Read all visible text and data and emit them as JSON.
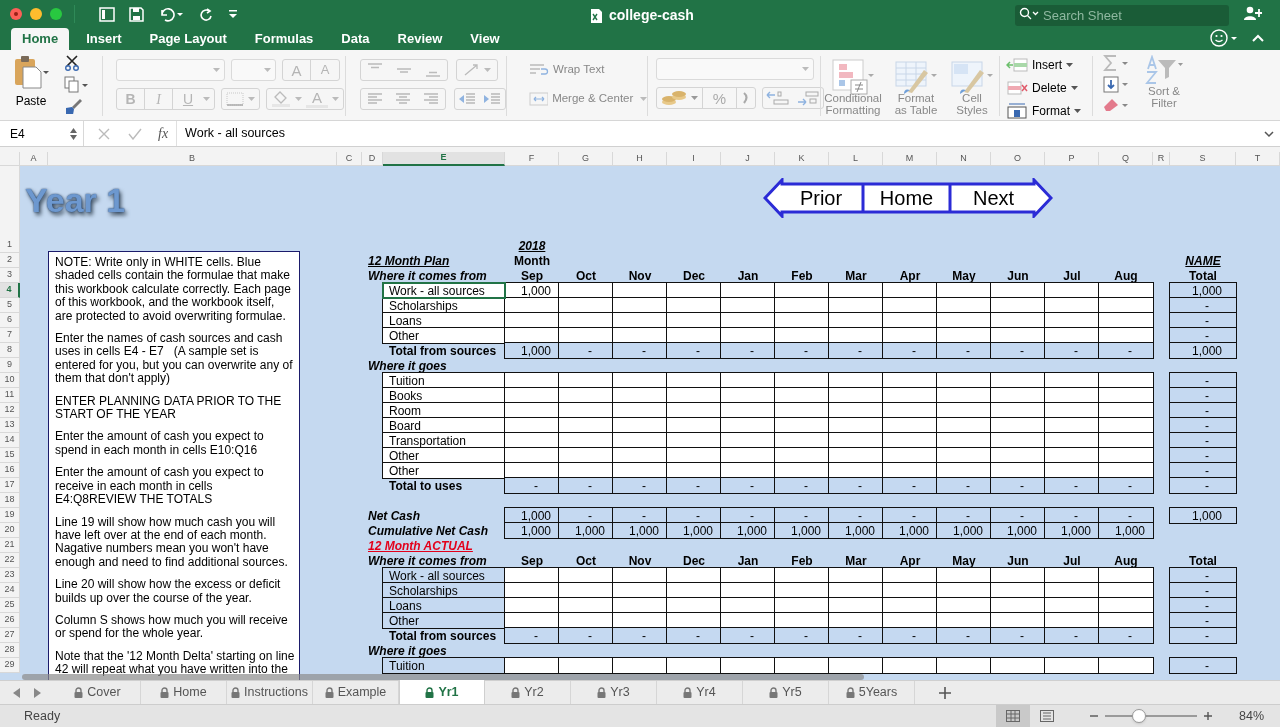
{
  "window": {
    "title": "college-cash",
    "search_placeholder": "Search Sheet"
  },
  "tabs": [
    {
      "label": "Home",
      "selected": true
    },
    {
      "label": "Insert",
      "selected": false
    },
    {
      "label": "Page Layout",
      "selected": false
    },
    {
      "label": "Formulas",
      "selected": false
    },
    {
      "label": "Data",
      "selected": false
    },
    {
      "label": "Review",
      "selected": false
    },
    {
      "label": "View",
      "selected": false
    }
  ],
  "ribbon": {
    "paste": "Paste",
    "grow_font": "A",
    "shrink_font": "A",
    "bold": "B",
    "italic": "I",
    "underline": "U",
    "font_color": "A",
    "wrap_text": "Wrap Text",
    "merge": "Merge & Center",
    "percent": "%",
    "styles": [
      "Conditional Formatting",
      "Format as Table",
      "Cell Styles"
    ],
    "cells": [
      "Insert",
      "Delete",
      "Format"
    ],
    "sort_filter": "Sort & Filter"
  },
  "formula_bar": {
    "name_box": "E4",
    "fx": "fx",
    "value": "Work - all sources"
  },
  "columns": [
    {
      "label": "A",
      "selected": false
    },
    {
      "label": "B",
      "selected": false
    },
    {
      "label": "C",
      "selected": false
    },
    {
      "label": "D",
      "selected": false
    },
    {
      "label": "E",
      "selected": true
    },
    {
      "label": "F",
      "selected": false
    },
    {
      "label": "G",
      "selected": false
    },
    {
      "label": "H",
      "selected": false
    },
    {
      "label": "I",
      "selected": false
    },
    {
      "label": "J",
      "selected": false
    },
    {
      "label": "K",
      "selected": false
    },
    {
      "label": "L",
      "selected": false
    },
    {
      "label": "M",
      "selected": false
    },
    {
      "label": "N",
      "selected": false
    },
    {
      "label": "O",
      "selected": false
    },
    {
      "label": "P",
      "selected": false
    },
    {
      "label": "Q",
      "selected": false
    },
    {
      "label": "R",
      "selected": false
    },
    {
      "label": "S",
      "selected": false
    },
    {
      "label": "T",
      "selected": false
    }
  ],
  "row_numbers": [
    {
      "label": "1",
      "selected": false
    },
    {
      "label": "2",
      "selected": false
    },
    {
      "label": "3",
      "selected": false
    },
    {
      "label": "4",
      "selected": true
    },
    {
      "label": "5",
      "selected": false
    },
    {
      "label": "6",
      "selected": false
    },
    {
      "label": "7",
      "selected": false
    },
    {
      "label": "8",
      "selected": false
    },
    {
      "label": "9",
      "selected": false
    },
    {
      "label": "10",
      "selected": false
    },
    {
      "label": "11",
      "selected": false
    },
    {
      "label": "12",
      "selected": false
    },
    {
      "label": "13",
      "selected": false
    },
    {
      "label": "14",
      "selected": false
    },
    {
      "label": "15",
      "selected": false
    },
    {
      "label": "16",
      "selected": false
    },
    {
      "label": "17",
      "selected": false
    },
    {
      "label": "18",
      "selected": false
    },
    {
      "label": "19",
      "selected": false
    },
    {
      "label": "20",
      "selected": false
    },
    {
      "label": "21",
      "selected": false
    },
    {
      "label": "22",
      "selected": false
    },
    {
      "label": "23",
      "selected": false
    },
    {
      "label": "24",
      "selected": false
    },
    {
      "label": "25",
      "selected": false
    },
    {
      "label": "26",
      "selected": false
    },
    {
      "label": "27",
      "selected": false
    },
    {
      "label": "28",
      "selected": false
    },
    {
      "label": "29",
      "selected": false
    }
  ],
  "sheet": {
    "title": "Year 1",
    "nav_buttons": [
      "Prior",
      "Home",
      "Next"
    ],
    "note": [
      "NOTE: Write only in WHITE cells. Blue shaded cells contain the formulae that make this workbook calculate correctly. Each page of this workbook, and the workbook itself, are protected to avoid overwriting formulae.",
      "Enter the names of cash sources and cash uses in cells E4 - E7   (A sample set is entered for you, but you can overwrite any of them that don't apply)",
      "ENTER PLANNING DATA PRIOR TO THE START OF THE YEAR",
      "Enter the amount of cash you expect to spend in each month in cells E10:Q16",
      "Enter the amount of cash you expect to receive in each month in cells E4:Q8REVIEW THE TOTALS",
      "Line 19 will show how much cash you will have left over at the end of each month. Nagative numbers mean you won't have enough and need to find additional sources.",
      "Line 20 will show how the excess or deficit builds up over the course of the year.",
      "Column S shows how much you will receive or spend for the whole year.",
      "Note that the '12 Month Delta' starting on line 42 will repeat what you have written into the"
    ]
  },
  "plan": {
    "year": "2018",
    "title": "12 Month Plan",
    "month_label": "Month",
    "name_label": "NAME",
    "labels_shaded": false,
    "sources_header": "Where it comes from",
    "months": [
      "Sep",
      "Oct",
      "Nov",
      "Dec",
      "Jan",
      "Feb",
      "Mar",
      "Apr",
      "May",
      "Jun",
      "Jul",
      "Aug"
    ],
    "total_header": "Total",
    "sources": [
      {
        "label": "Work - all sources",
        "selected": true,
        "values": [
          "1,000"
        ],
        "total": "1,000"
      },
      {
        "label": "Scholarships",
        "selected": false,
        "total": "-"
      },
      {
        "label": "Loans",
        "selected": false,
        "total": "-"
      },
      {
        "label": "Other",
        "selected": false,
        "total": "-"
      }
    ],
    "sources_total": {
      "label": "Total from sources",
      "values": [
        "1,000",
        "-",
        "-",
        "-",
        "-",
        "-",
        "-",
        "-",
        "-",
        "-",
        "-",
        "-"
      ],
      "total": "1,000"
    },
    "uses_header": "Where it goes",
    "uses": [
      {
        "label": "Tuition",
        "selected": false,
        "total": "-"
      },
      {
        "label": "Books",
        "selected": false,
        "total": "-"
      },
      {
        "label": "Room",
        "selected": false,
        "total": "-"
      },
      {
        "label": "Board",
        "selected": false,
        "total": "-"
      },
      {
        "label": "Transportation",
        "selected": false,
        "total": "-"
      },
      {
        "label": "Other",
        "selected": false,
        "total": "-"
      },
      {
        "label": "Other",
        "selected": false,
        "total": "-"
      }
    ],
    "uses_total": {
      "label": "Total to uses",
      "values": [
        "-",
        "-",
        "-",
        "-",
        "-",
        "-",
        "-",
        "-",
        "-",
        "-",
        "-",
        "-"
      ],
      "total": "-"
    },
    "net_cash": {
      "label": "Net Cash",
      "values": [
        "1,000",
        "-",
        "-",
        "-",
        "-",
        "-",
        "-",
        "-",
        "-",
        "-",
        "-",
        "-"
      ],
      "total": "1,000"
    },
    "cumulative": {
      "label": "Cumulative Net Cash",
      "values": [
        "1,000",
        "1,000",
        "1,000",
        "1,000",
        "1,000",
        "1,000",
        "1,000",
        "1,000",
        "1,000",
        "1,000",
        "1,000",
        "1,000"
      ]
    }
  },
  "actual": {
    "title": "12 Month ACTUAL",
    "labels_shaded": true,
    "sources_header": "Where it comes from",
    "months": [
      "Sep",
      "Oct",
      "Nov",
      "Dec",
      "Jan",
      "Feb",
      "Mar",
      "Apr",
      "May",
      "Jun",
      "Jul",
      "Aug"
    ],
    "total_header": "Total",
    "sources": [
      {
        "label": "Work - all sources",
        "selected": false,
        "total": "-"
      },
      {
        "label": "Scholarships",
        "selected": false,
        "total": "-"
      },
      {
        "label": "Loans",
        "selected": false,
        "total": "-"
      },
      {
        "label": "Other",
        "selected": false,
        "total": "-"
      }
    ],
    "sources_total": {
      "label": "Total from sources",
      "values": [
        "-",
        "-",
        "-",
        "-",
        "-",
        "-",
        "-",
        "-",
        "-",
        "-",
        "-",
        "-"
      ],
      "total": "-"
    },
    "uses_header": "Where it goes",
    "uses": [
      {
        "label": "Tuition",
        "selected": false,
        "total": "-"
      }
    ]
  },
  "sheet_tabs": [
    {
      "label": "Cover",
      "selected": false
    },
    {
      "label": "Home",
      "selected": false
    },
    {
      "label": "Instructions",
      "selected": false
    },
    {
      "label": "Example",
      "selected": false
    },
    {
      "label": "Yr1",
      "selected": true
    },
    {
      "label": "Yr2",
      "selected": false
    },
    {
      "label": "Yr3",
      "selected": false
    },
    {
      "label": "Yr4",
      "selected": false
    },
    {
      "label": "Yr5",
      "selected": false
    },
    {
      "label": "5Years",
      "selected": false
    }
  ],
  "status_bar": {
    "text": "Ready",
    "views": [
      {
        "kind": "normal",
        "selected": true
      },
      {
        "kind": "page_layout",
        "selected": false
      }
    ],
    "zoom": {
      "level": 0.35,
      "reading": "84%"
    }
  }
}
